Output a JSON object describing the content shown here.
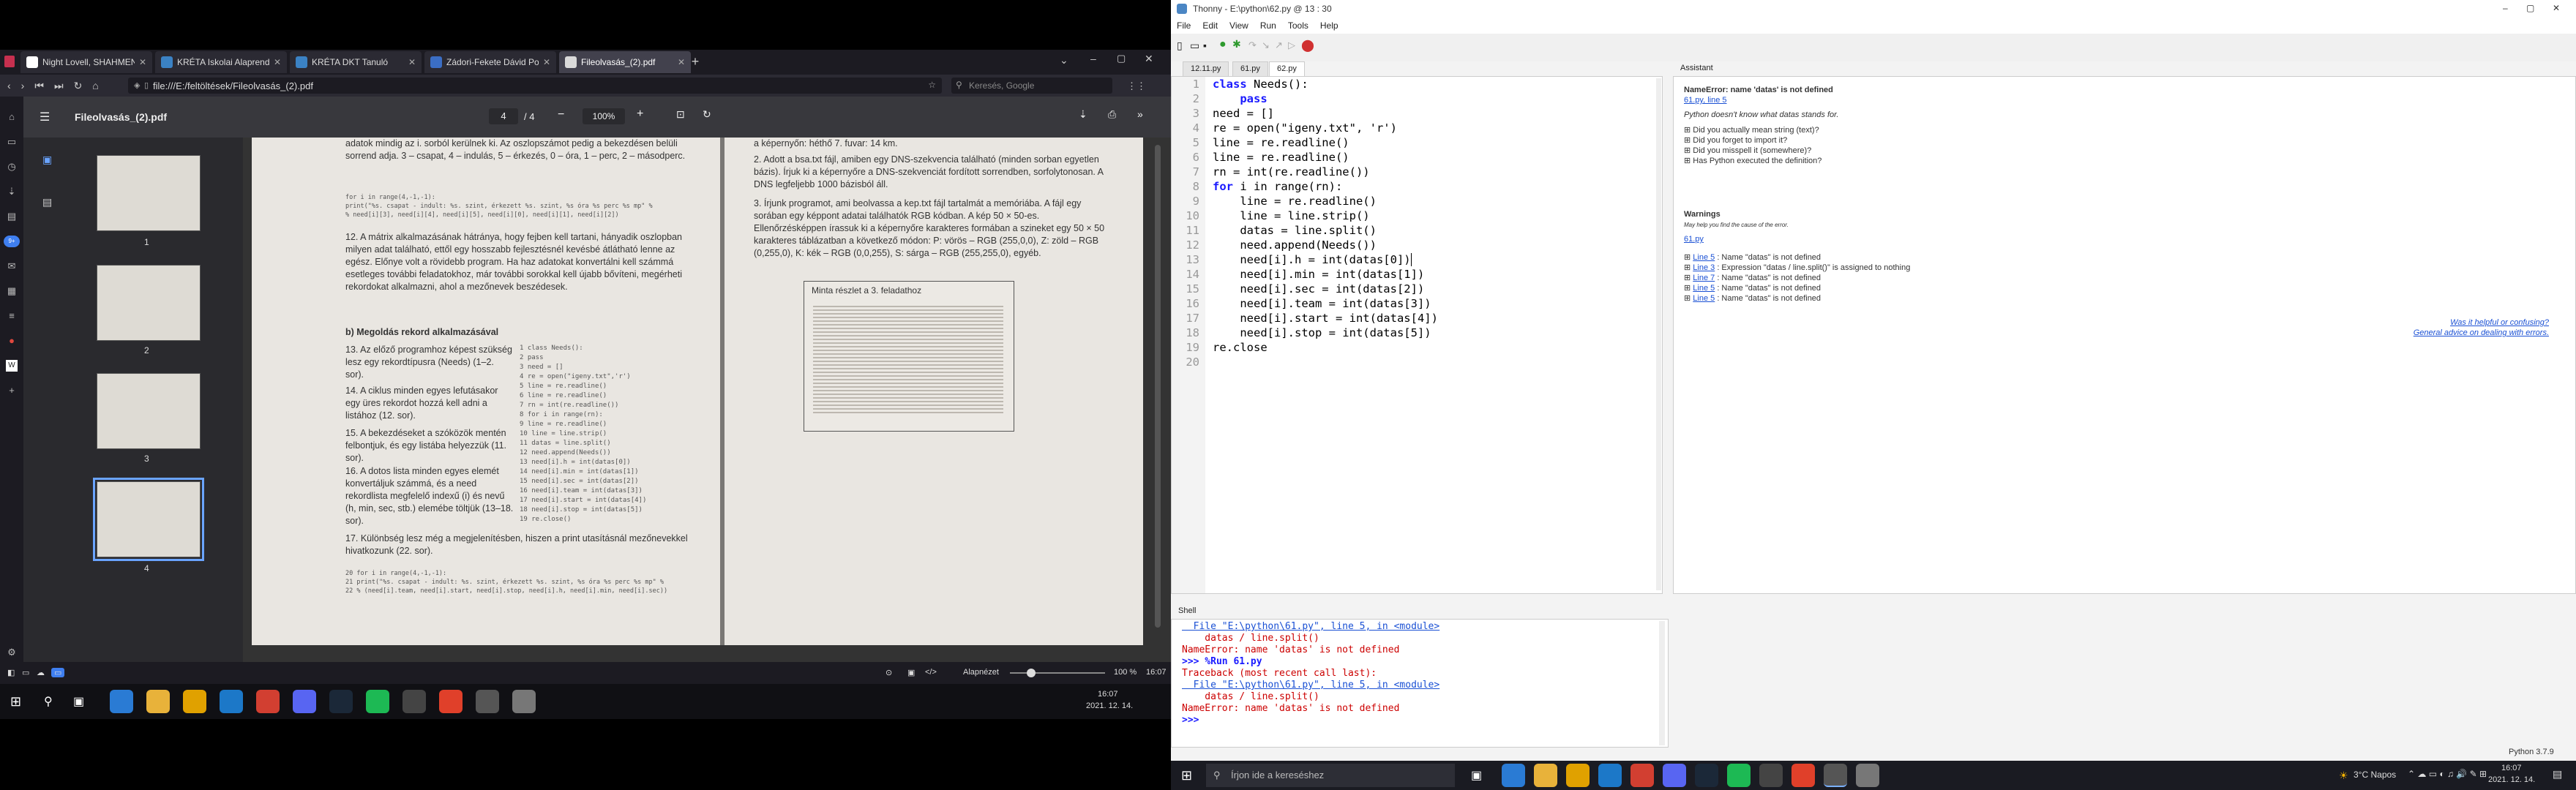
{
  "browser": {
    "tabs": [
      {
        "label": "Night Lovell, SHAHMEN, A",
        "color": "#ffffff"
      },
      {
        "label": "KRÉTA Iskolai Alaprendszer",
        "color": "#3b82c4"
      },
      {
        "label": "KRÉTA DKT Tanuló",
        "color": "#3b82c4"
      },
      {
        "label": "Zádori-Fekete Dávid Postu",
        "color": "#3b6ec4"
      },
      {
        "label": "Fileolvasás_(2).pdf",
        "color": "#d9d9d9"
      }
    ],
    "url": "file:///E:/feltöltések/Fileolvasás_(2).pdf",
    "search_placeholder": "Keresés, Google",
    "pdf": {
      "title": "Fileolvasás_(2).pdf",
      "page_current": "4",
      "page_total": "/ 4",
      "zoom": "100%",
      "thumb_numbers": [
        "1",
        "2",
        "3",
        "4"
      ],
      "left_page": {
        "intro": "adatok mindig az i. sorból kerülnek ki. Az oszlopszámot pedig a bekezdésen belüli sorrend adja. 3 – csapat, 4 – indulás, 5 – érkezés, 0 – óra, 1 – perc, 2 – másodperc.",
        "code1": [
          "for i in range(4,-1,-1):",
          "    print(\"%s. csapat - indult: %s. szint, érkezett %s. szint, %s óra %s perc %s mp\" %",
          "          % need[i][3], need[i][4], need[i][5], need[i][0], need[i][1], need[i][2])"
        ],
        "p12": "12. A mátrix alkalmazásának hátránya, hogy fejben kell tartani, hányadik oszlopban milyen adat található, ettől egy hosszabb fejlesztésnél kevésbé átlátható lenne az egész. Előnye volt a rövidebb program. Ha haz adatokat konvertálni kell számmá esetleges további feladatokhoz, már további sorokkal kell újabb bővíteni, megérheti rekordokat alkalmazni, ahol a mezőnevek beszédesek.",
        "heading": "b) Megoldás rekord alkalmazásával",
        "p13": "13. Az előző programhoz képest szükség lesz egy rekordtípusra (Needs) (1–2. sor).",
        "p14": "14. A ciklus minden egyes lefutásakor egy üres rekordot hozzá kell adni a listához (12. sor).",
        "p15": "15. A bekezdéseket a szóközök mentén felbontjuk, és egy listába helyezzük (11. sor).",
        "p16": "16. A dotos lista minden egyes elemét konvertáljuk számmá, és a need rekordlista megfelelő indexű (i) és nevű (h, min, sec, stb.) elemébe töltjük (13–18. sor).",
        "p17": "17. Különbség lesz még a megjelenítésben, hiszen a print utasításnál mezőnevekkel hivatkozunk (22. sor).",
        "code2": [
          "1  class Needs():",
          "2      pass",
          "3  need = []",
          "4  re = open(\"igeny.txt\",'r')",
          "5  line = re.readline()",
          "6  line = re.readline()",
          "7  rn = int(re.readline())",
          "8  for i in range(rn):",
          "9      line = re.readline()",
          "10     line = line.strip()",
          "11     datas = line.split()",
          "12     need.append(Needs())",
          "13     need[i].h = int(datas[0])",
          "14     need[i].min = int(datas[1])",
          "15     need[i].sec = int(datas[2])",
          "16     need[i].team = int(datas[3])",
          "17     need[i].start = int(datas[4])",
          "18     need[i].stop = int(datas[5])",
          "19 re.close()"
        ],
        "code3": [
          "20 for i in range(4,-1,-1):",
          "21     print(\"%s. csapat - indult: %s. szint, érkezett %s. szint, %s óra %s perc %s mp\" %",
          "22           % (need[i].team, need[i].start, need[i].stop, need[i].h, need[i].min, need[i].sec))"
        ]
      },
      "right_page": {
        "p2a": "a képernyőn: héthő 7. fuvar: 14 km.",
        "p2": "2. Adott a bsa.txt fájl, amiben egy DNS-szekvencia található (minden sorban egyetlen bázis). Írjuk ki a képernyőre a DNS-szekvenciát fordított sorrendben, sorfolytonosan. A DNS legfeljebb 1000 bázisból áll.",
        "p3": "3. Írjunk programot, ami beolvassa a kep.txt fájl tartalmát a memóriába. A fájl egy sorában egy képpont adatai találhatók RGB kódban. A kép 50 × 50-es. Ellenőrzésképpen írassuk ki a képernyőre karakteres formában a szineket egy 50 × 50 karakteres táblázatban a következő módon: P: vörös – RGB (255,0,0), Z: zöld – RGB (0,255,0), K: kék – RGB (0,0,255), S: sárga – RGB (255,255,0), egyéb.",
        "box_title": "Minta részlet a 3. feladathoz"
      }
    },
    "status": {
      "zoom": "100 %",
      "label": "Alapnézet",
      "clock_time": "16:07",
      "clock_date": "2021. 12. 14."
    }
  },
  "thonny": {
    "title": "Thonny  -  E:\\python\\62.py  @  13 : 30",
    "menu": [
      "File",
      "Edit",
      "View",
      "Run",
      "Tools",
      "Help"
    ],
    "editor_tabs": [
      "12.11.py",
      "61.py",
      "62.py"
    ],
    "line_numbers": [
      "1",
      "2",
      "3",
      "4",
      "5",
      "6",
      "7",
      "8",
      "9",
      "10",
      "11",
      "12",
      "13",
      "14",
      "15",
      "16",
      "17",
      "18",
      "19",
      "20"
    ],
    "code": [
      {
        "kw": "class ",
        "rest": "Needs():"
      },
      {
        "kw": "    pass",
        "rest": ""
      },
      {
        "kw": "",
        "rest": "need = []"
      },
      {
        "kw": "",
        "rest": "re = open(\"igeny.txt\", 'r')"
      },
      {
        "kw": "",
        "rest": "line = re.readline()"
      },
      {
        "kw": "",
        "rest": "line = re.readline()"
      },
      {
        "kw": "",
        "rest": "rn = int(re.readline())"
      },
      {
        "kw": "for ",
        "rest": "i in range(rn):"
      },
      {
        "kw": "",
        "rest": "    line = re.readline()"
      },
      {
        "kw": "",
        "rest": "    line = line.strip()"
      },
      {
        "kw": "",
        "rest": "    datas = line.split()"
      },
      {
        "kw": "",
        "rest": "    need.append(Needs())"
      },
      {
        "kw": "",
        "rest": "    need[i].h = int(datas[0])"
      },
      {
        "kw": "",
        "rest": "    need[i].min = int(datas[1])"
      },
      {
        "kw": "",
        "rest": "    need[i].sec = int(datas[2])"
      },
      {
        "kw": "",
        "rest": "    need[i].team = int(datas[3])"
      },
      {
        "kw": "",
        "rest": "    need[i].start = int(datas[4])"
      },
      {
        "kw": "",
        "rest": "    need[i].stop = int(datas[5])"
      },
      {
        "kw": "",
        "rest": "re.close"
      },
      {
        "kw": "",
        "rest": ""
      }
    ],
    "assistant": {
      "tab": "Assistant",
      "error_title": "NameError: name 'datas' is not defined",
      "error_link": "61.py, line 5",
      "error_desc": "Python doesn't know what datas stands for.",
      "questions": [
        "Did you actually mean string (text)?",
        "Did you forget to import it?",
        "Did you misspell it (somewhere)?",
        "Has Python executed the definition?"
      ],
      "warnings_title": "Warnings",
      "warnings_sub": "May help you find the cause of the error.",
      "warnings_file": "61.py",
      "warnings": [
        {
          "line": "Line 5",
          "text": " : Name \"datas\" is not defined"
        },
        {
          "line": "Line 3",
          "text": " : Expression \"datas / line.split()\" is assigned to nothing"
        },
        {
          "line": "Line 7",
          "text": " : Name \"datas\" is not defined"
        },
        {
          "line": "Line 5",
          "text": " : Name \"datas\" is not defined"
        },
        {
          "line": "Line 5",
          "text": " : Name \"datas\" is not defined"
        }
      ],
      "helpful": "Was it helpful or confusing?",
      "advice": "General advice on dealing with errors."
    },
    "shell": {
      "tab": "Shell",
      "lines": [
        {
          "cls": "lnk",
          "text": "  File \"E:\\python\\61.py\", line 5, in <module>"
        },
        {
          "cls": "err",
          "text": "    datas / line.split()"
        },
        {
          "cls": "err",
          "text": "NameError: name 'datas' is not defined"
        },
        {
          "cls": "",
          "text": ""
        },
        {
          "cls": "",
          "text": ">>> %Run 61.py"
        },
        {
          "cls": "err",
          "text": "Traceback (most recent call last):"
        },
        {
          "cls": "lnk",
          "text": "  File \"E:\\python\\61.py\", line 5, in <module>"
        },
        {
          "cls": "err",
          "text": "    datas / line.split()"
        },
        {
          "cls": "err",
          "text": "NameError: name 'datas' is not defined"
        },
        {
          "cls": "",
          "text": ""
        },
        {
          "cls": "",
          "text": ">>>"
        }
      ]
    },
    "python_version": "Python 3.7.9"
  },
  "taskbar": {
    "search_placeholder": "Írjon ide a kereséshez",
    "weather": "3°C  Napos",
    "clock_time": "16:07",
    "clock_date": "2021. 12. 14."
  }
}
